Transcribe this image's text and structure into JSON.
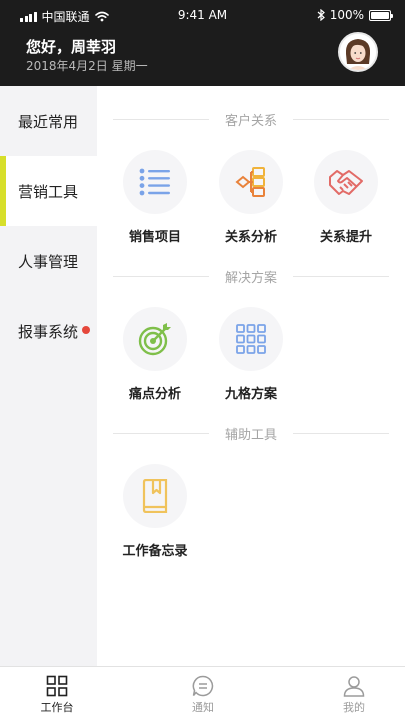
{
  "status_bar": {
    "carrier": "中国联通",
    "time": "9:41 AM",
    "battery": "100%",
    "battery_level": 1.0
  },
  "header": {
    "greeting": "您好，周莘羽",
    "date": "2018年4月2日 星期一",
    "avatar_icon": "avatar-photo"
  },
  "sidebar": {
    "items": [
      {
        "label": "最近常用",
        "active": false
      },
      {
        "label": "营销工具",
        "active": true
      },
      {
        "label": "人事管理",
        "active": false
      },
      {
        "label": "报事系统",
        "active": false,
        "badge": true
      }
    ],
    "active_color": "#d7df2a",
    "badge_color": "#e5473b"
  },
  "sections": [
    {
      "title": "客户关系",
      "items": [
        {
          "label": "销售项目",
          "icon": "list-icon"
        },
        {
          "label": "关系分析",
          "icon": "flowchart-icon"
        },
        {
          "label": "关系提升",
          "icon": "handshake-icon"
        }
      ]
    },
    {
      "title": "解决方案",
      "items": [
        {
          "label": "痛点分析",
          "icon": "target-icon"
        },
        {
          "label": "九格方案",
          "icon": "grid-icon"
        }
      ]
    },
    {
      "title": "辅助工具",
      "items": [
        {
          "label": "工作备忘录",
          "icon": "notebook-icon"
        }
      ]
    }
  ],
  "tabbar": {
    "tabs": [
      {
        "label": "工作台",
        "icon": "dashboard-icon",
        "active": true
      },
      {
        "label": "通知",
        "icon": "message-icon",
        "active": false
      },
      {
        "label": "我的",
        "icon": "user-icon",
        "active": false
      }
    ]
  }
}
